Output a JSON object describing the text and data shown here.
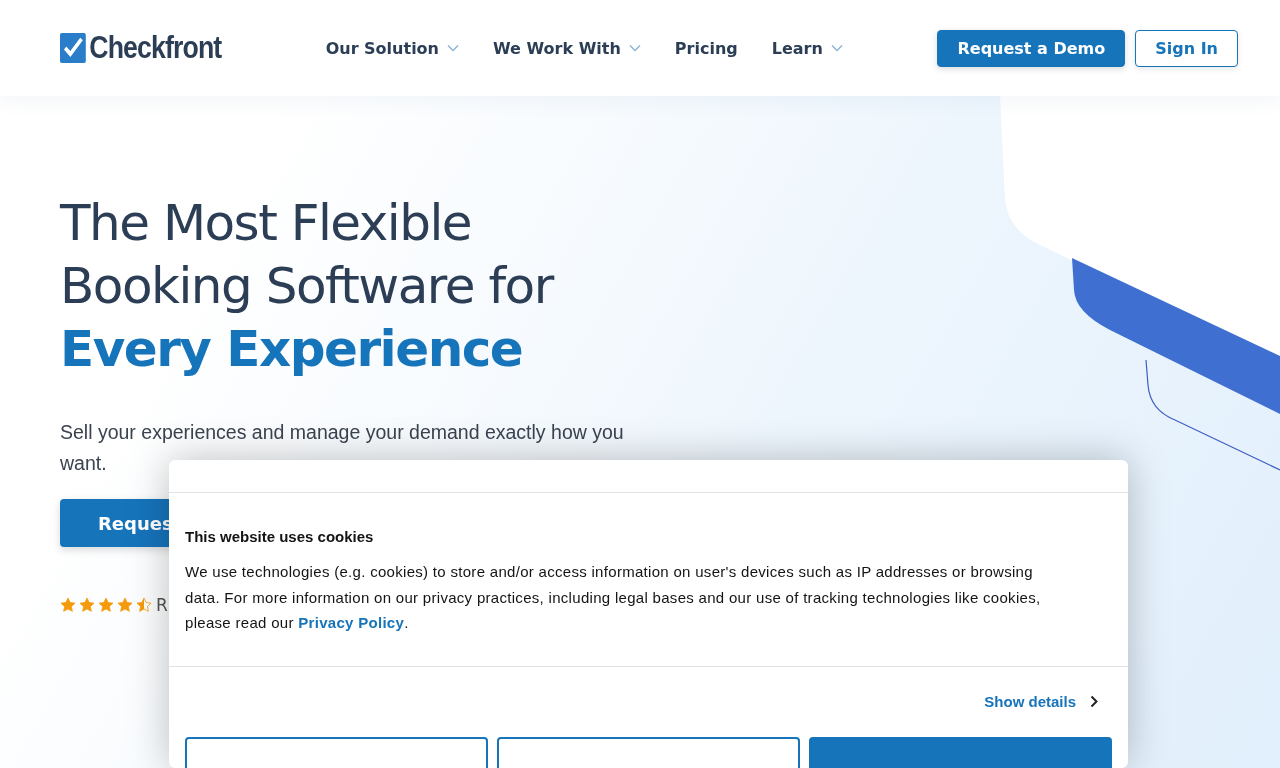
{
  "header": {
    "logo": "Checkfront",
    "nav": [
      {
        "label": "Our Solution",
        "dropdown": true
      },
      {
        "label": "We Work With",
        "dropdown": true
      },
      {
        "label": "Pricing",
        "dropdown": false
      },
      {
        "label": "Learn",
        "dropdown": true
      }
    ],
    "demo_button": "Request a Demo",
    "signin_button": "Sign In"
  },
  "hero": {
    "title_lines": [
      "The Most Flexible",
      "Booking Software for"
    ],
    "title_highlight": "Every Experience",
    "subtitle": "Sell your experiences and manage your demand exactly how you want.",
    "cta_button": "Reques",
    "rating": {
      "stars": 4.5,
      "text": "R"
    }
  },
  "cookie_dialog": {
    "title": "This website uses cookies",
    "body": "We use technologies (e.g. cookies) to store and/or access information on user's devices such as IP addresses or browsing data. For more information on our privacy practices, including legal bases and our use of tracking technologies like cookies, please read our ",
    "link": "Privacy Policy",
    "body_end": ".",
    "show_details": "Show details",
    "buttons": [
      {
        "kind": "outline"
      },
      {
        "kind": "outline"
      },
      {
        "kind": "filled"
      }
    ]
  }
}
